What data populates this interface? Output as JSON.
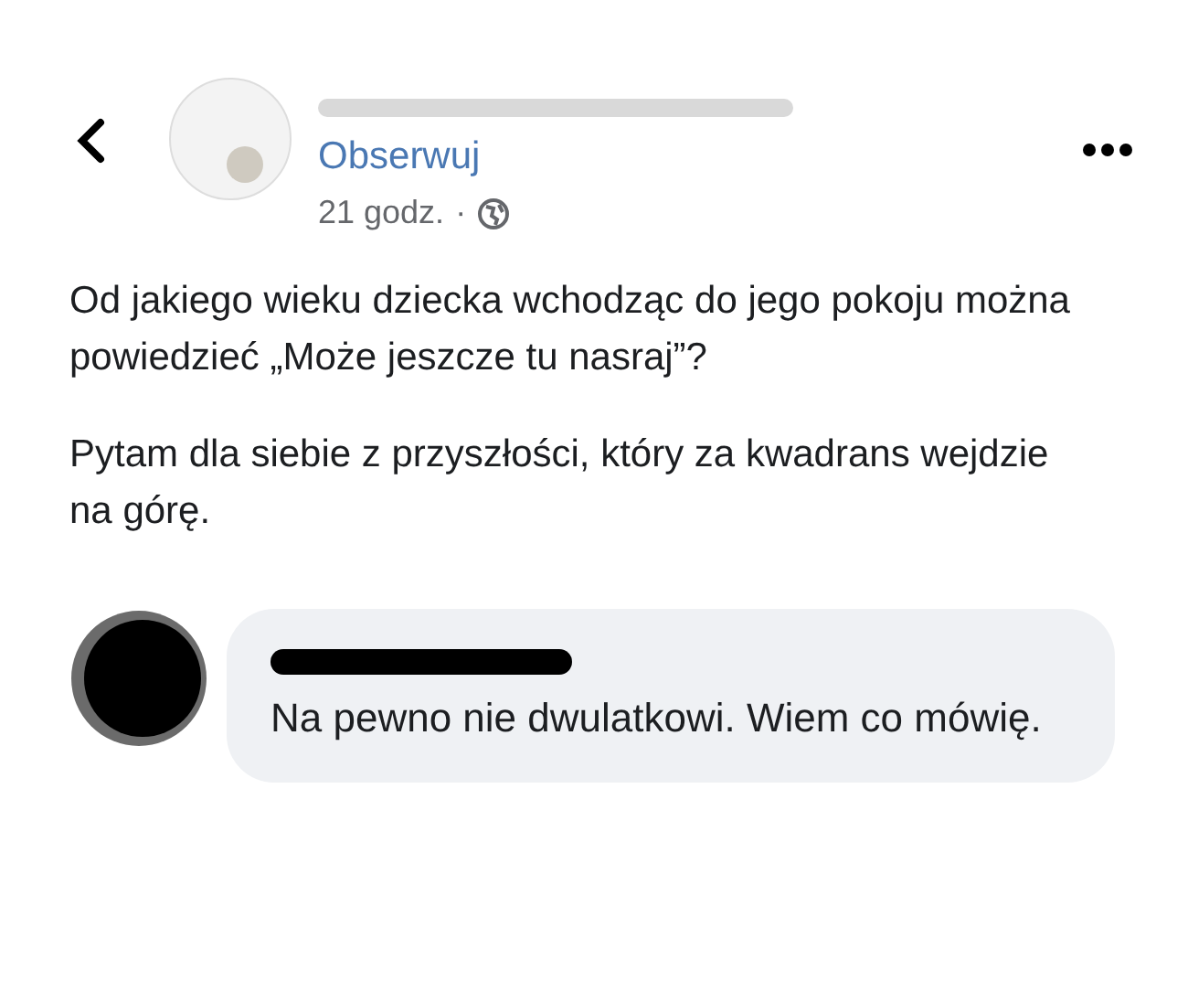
{
  "header": {
    "follow_link": "Obserwuj",
    "timestamp": "21 godz.",
    "separator": "·"
  },
  "post": {
    "paragraphs": [
      "Od jakiego wieku dziecka wchodząc do jego pokoju można powiedzieć „Może jeszcze tu nasraj”?",
      "Pytam dla siebie z przyszłości, który za kwadrans wejdzie na górę."
    ]
  },
  "comments": [
    {
      "text": "Na pewno nie dwulatkowi. Wiem co mówię."
    }
  ]
}
